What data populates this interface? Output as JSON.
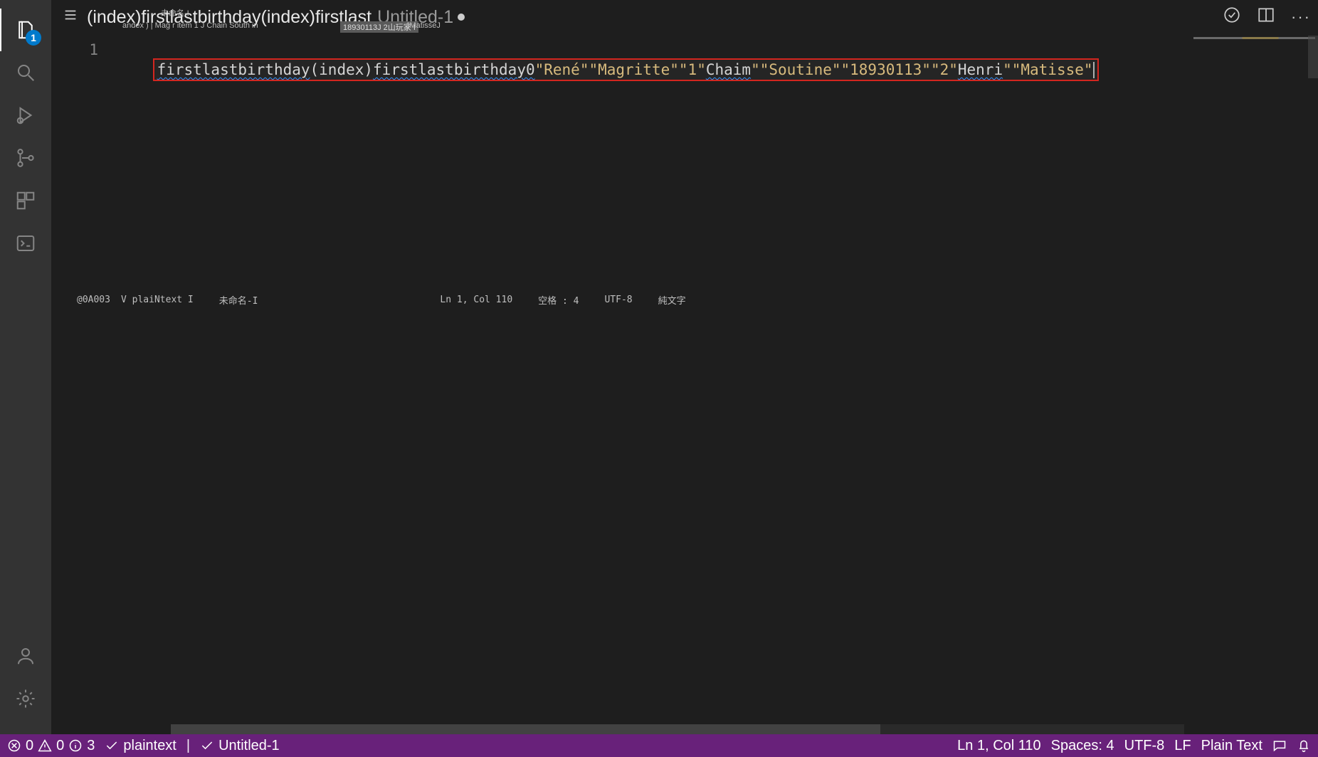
{
  "activity": {
    "explorer_badge": "1"
  },
  "breadcrumb": {
    "path_text": "(index)firstlastbirthday(index)firstlast",
    "tab_label": "Untitled-1"
  },
  "tiny_labels": {
    "a": "andex ) | Mag r item 1 J Chain South in",
    "b": "未命名-I",
    "c": "18930113J 2山玩家 I",
    "d": "JMatisseJ"
  },
  "editor": {
    "line_number": "1",
    "segments": {
      "s1": "firstlastbirthday",
      "s2": "(index)",
      "s3": "firstlastbirthday0",
      "q1": "\"René\"",
      "q2": "\"Magritte\"",
      "q3": "\"1\"",
      "s4": "Chaim",
      "q4": "\"\"Soutine\"",
      "q5": "\"18930113\"",
      "q6": "\"2\"",
      "s5": "Henri",
      "q7": "\"\"Matisse\""
    }
  },
  "float_status": {
    "side_id": "@0A003",
    "lang_hint": "V plaiNtext I",
    "unnamed": "未命名-I",
    "lncol": "Ln 1, Col 110",
    "spaces": "空格 : 4",
    "enc": "UTF-8",
    "mode": "純文字"
  },
  "statusbar": {
    "errors": "0",
    "warnings": "0",
    "infos": "3",
    "lang_check": "plaintext",
    "file_check": "Untitled-1",
    "lncol": "Ln 1, Col 110",
    "spaces": "Spaces: 4",
    "encoding": "UTF-8",
    "eol": "LF",
    "language": "Plain Text"
  }
}
